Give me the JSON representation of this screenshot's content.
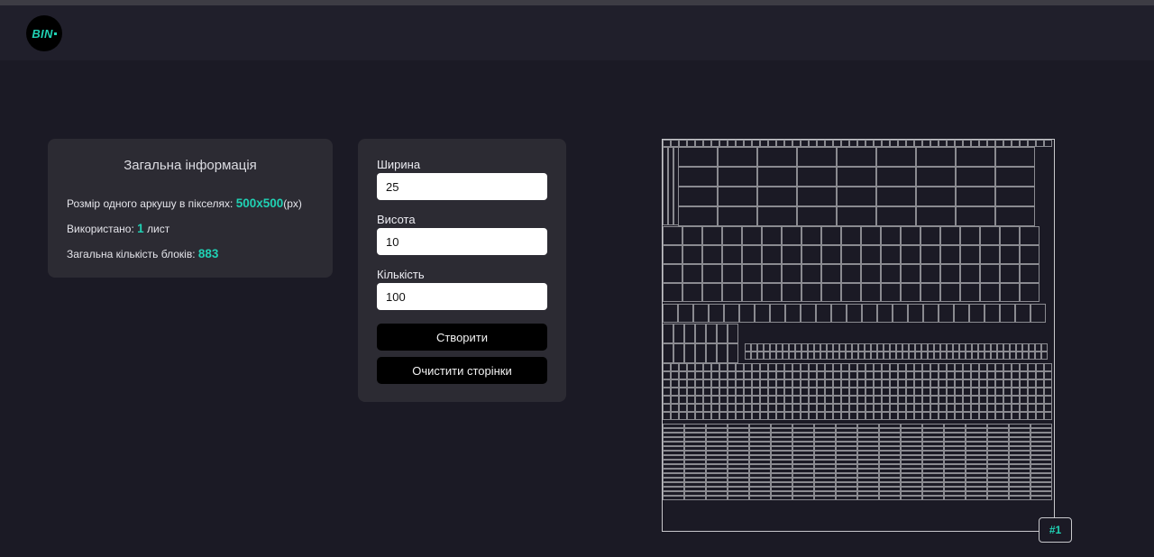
{
  "app": {
    "logo_text": "BIN"
  },
  "info": {
    "title": "Загальна інформація",
    "sheet_size_label": "Розмір одного аркушу в пікселях:",
    "sheet_size_value": "500x500",
    "sheet_size_unit": "(px)",
    "used_label": "Використано:",
    "used_value": "1",
    "used_unit": "лист",
    "blocks_label": "Загальна кількість блоків:",
    "blocks_value": "883"
  },
  "form": {
    "width_label": "Ширина",
    "width_value": "25",
    "height_label": "Висота",
    "height_value": "10",
    "count_label": "Кількість",
    "count_value": "100",
    "create_button": "Створити",
    "clear_button": "Очистити сторінки"
  },
  "sheet": {
    "badge": "#1"
  },
  "colors": {
    "accent": "#20d1b4",
    "background": "#1b1a25",
    "card": "#2c2b33",
    "block_stroke": "#8a8a90"
  }
}
